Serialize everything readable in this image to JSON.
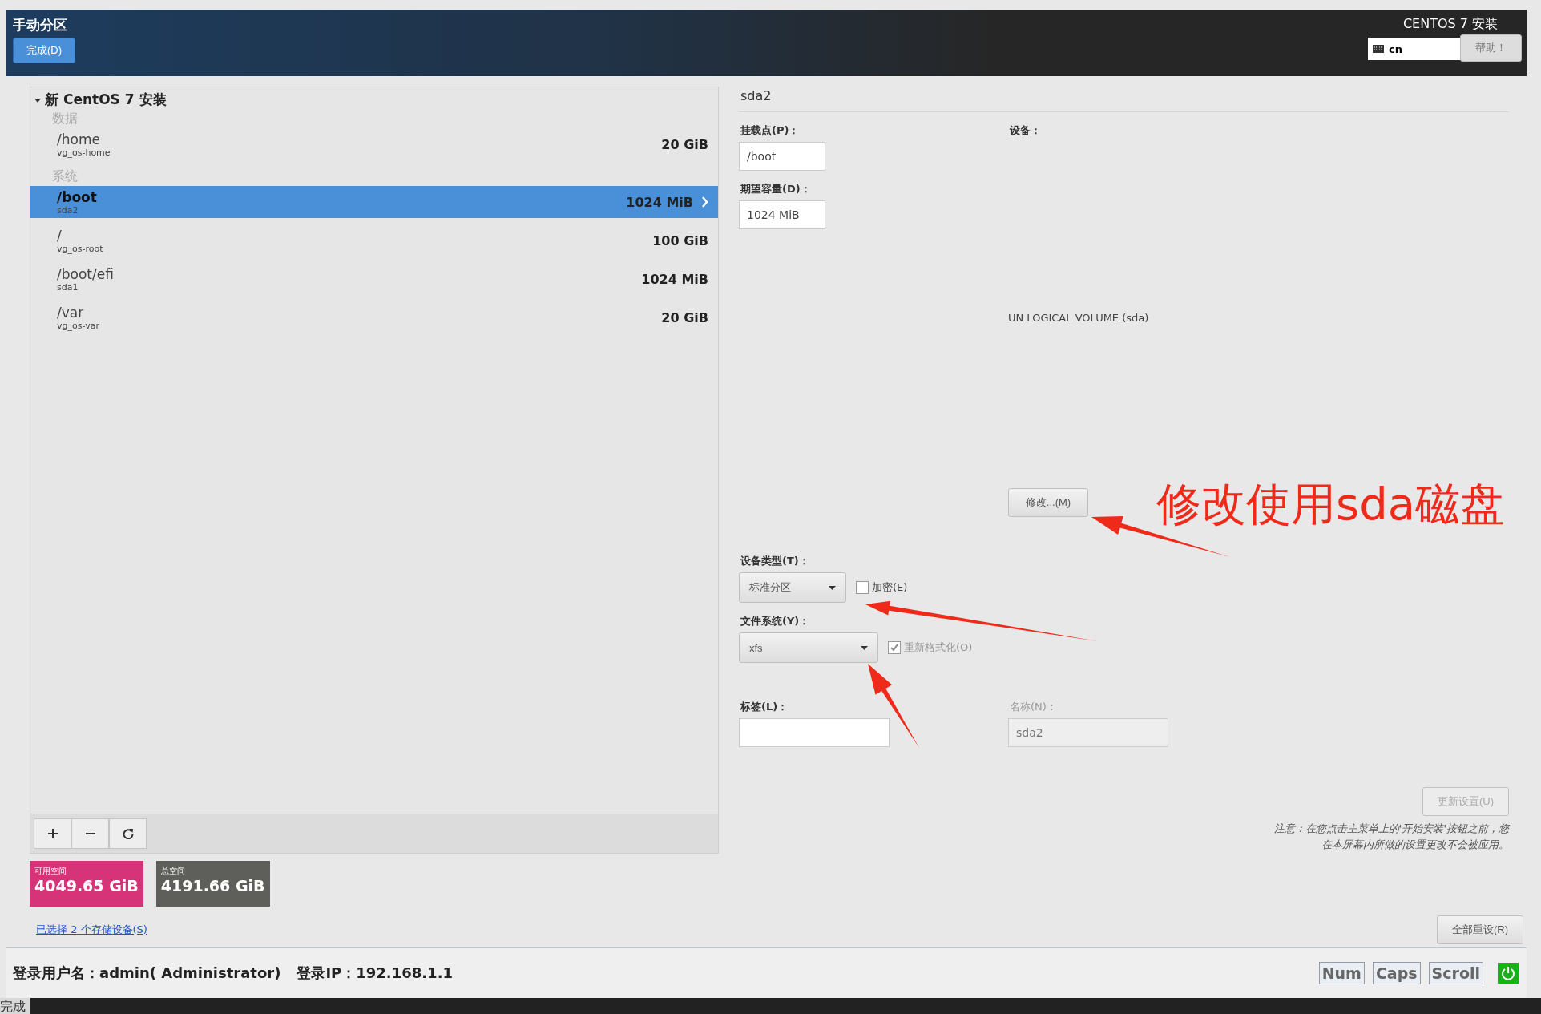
{
  "header": {
    "title": "手动分区",
    "done_button": "完成(D)",
    "product": "CENTOS 7 安装",
    "keyboard_layout": "cn",
    "help_button": "帮助！"
  },
  "tree": {
    "label": "新 CentOS 7 安装",
    "expanded": true,
    "groups": [
      {
        "label": "数据",
        "items": [
          {
            "mount": "/home",
            "device": "vg_os-home",
            "size": "20 GiB",
            "selected": false
          }
        ]
      },
      {
        "label": "系统",
        "items": [
          {
            "mount": "/boot",
            "device": "sda2",
            "size": "1024 MiB",
            "selected": true
          },
          {
            "mount": "/",
            "device": "vg_os-root",
            "size": "100 GiB",
            "selected": false
          },
          {
            "mount": "/boot/efi",
            "device": "sda1",
            "size": "1024 MiB",
            "selected": false
          },
          {
            "mount": "/var",
            "device": "vg_os-var",
            "size": "20 GiB",
            "selected": false
          }
        ]
      }
    ]
  },
  "toolbar": [
    {
      "kind": "add"
    },
    {
      "kind": "remove"
    },
    {
      "kind": "refresh"
    }
  ],
  "space": [
    {
      "kind": "available",
      "label": "可用空间",
      "value": "4049.65 GiB"
    },
    {
      "kind": "total",
      "label": "总空间",
      "value": "4191.66 GiB"
    }
  ],
  "storage_link": "已选择 2 个存储设备(S)",
  "details": {
    "title": "sda2",
    "mount_point": {
      "label": "挂载点(P)：",
      "value": "/boot"
    },
    "capacity": {
      "label": "期望容量(D)：",
      "value": "1024 MiB"
    },
    "device": {
      "label": "设备：",
      "value": "UN LOGICAL VOLUME (sda)"
    },
    "modify_button": "修改...(M)",
    "device_type": {
      "label": "设备类型(T)：",
      "value": "标准分区"
    },
    "encrypt": {
      "label": "加密(E)",
      "checked": false
    },
    "file_system": {
      "label": "文件系统(Y)：",
      "value": "xfs"
    },
    "reformat": {
      "label": "重新格式化(O)",
      "checked": true,
      "disabled": true
    },
    "label_field": {
      "label": "标签(L)："
    },
    "name_field": {
      "label": "名称(N)：",
      "value": "sda2",
      "disabled": true
    },
    "update_button": {
      "label": "更新设置(U)",
      "disabled": true
    },
    "note": [
      "注意：在您点击主菜单上的'开始安装'按钮之前，您",
      "在本屏幕内所做的设置更改不会被应用。"
    ],
    "reset_button": "全部重设(R)"
  },
  "annotation": {
    "text": "修改使用sda磁盘"
  },
  "status_bar": {
    "user": "登录用户名：admin( Administrator)",
    "ip": "登录IP：192.168.1.1",
    "keys": [
      "Num",
      "Caps",
      "Scroll"
    ]
  },
  "bottom_strip": "完成"
}
